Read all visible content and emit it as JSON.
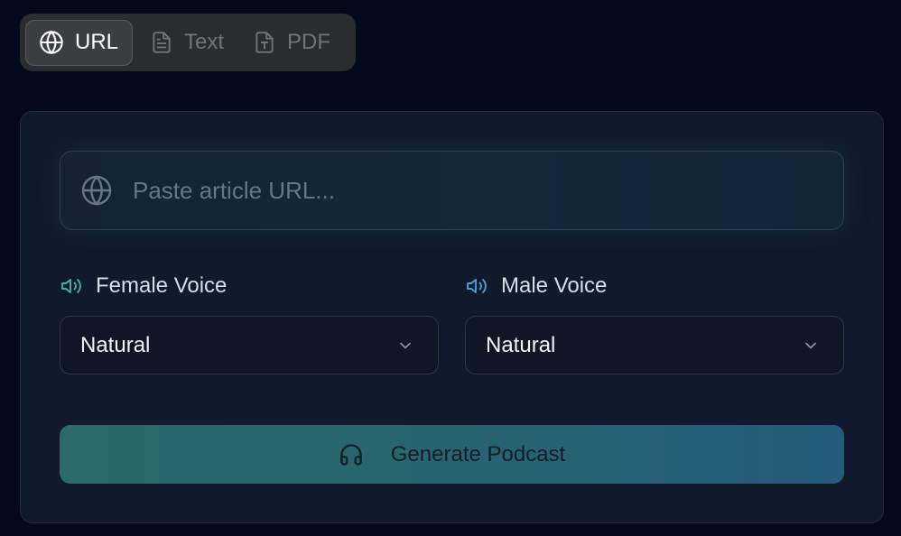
{
  "tabs": [
    {
      "label": "URL",
      "icon": "globe-icon",
      "active": true
    },
    {
      "label": "Text",
      "icon": "document-icon",
      "active": false
    },
    {
      "label": "PDF",
      "icon": "pdf-file-icon",
      "active": false
    }
  ],
  "url_field": {
    "placeholder": "Paste article URL...",
    "value": "",
    "icon": "globe-icon"
  },
  "voices": {
    "female": {
      "label": "Female Voice",
      "selected": "Natural",
      "icon": "speaker-icon"
    },
    "male": {
      "label": "Male Voice",
      "selected": "Natural",
      "icon": "speaker-icon"
    }
  },
  "generate": {
    "label": "Generate Podcast",
    "icon": "headphones-icon"
  },
  "colors": {
    "background": "#03091a",
    "card": "#111a2c",
    "speaker_female": "#3fb3a8",
    "speaker_male": "#4a9fd6",
    "button_gradient_start": "#2a6a6a",
    "button_gradient_end": "#245b7c"
  }
}
